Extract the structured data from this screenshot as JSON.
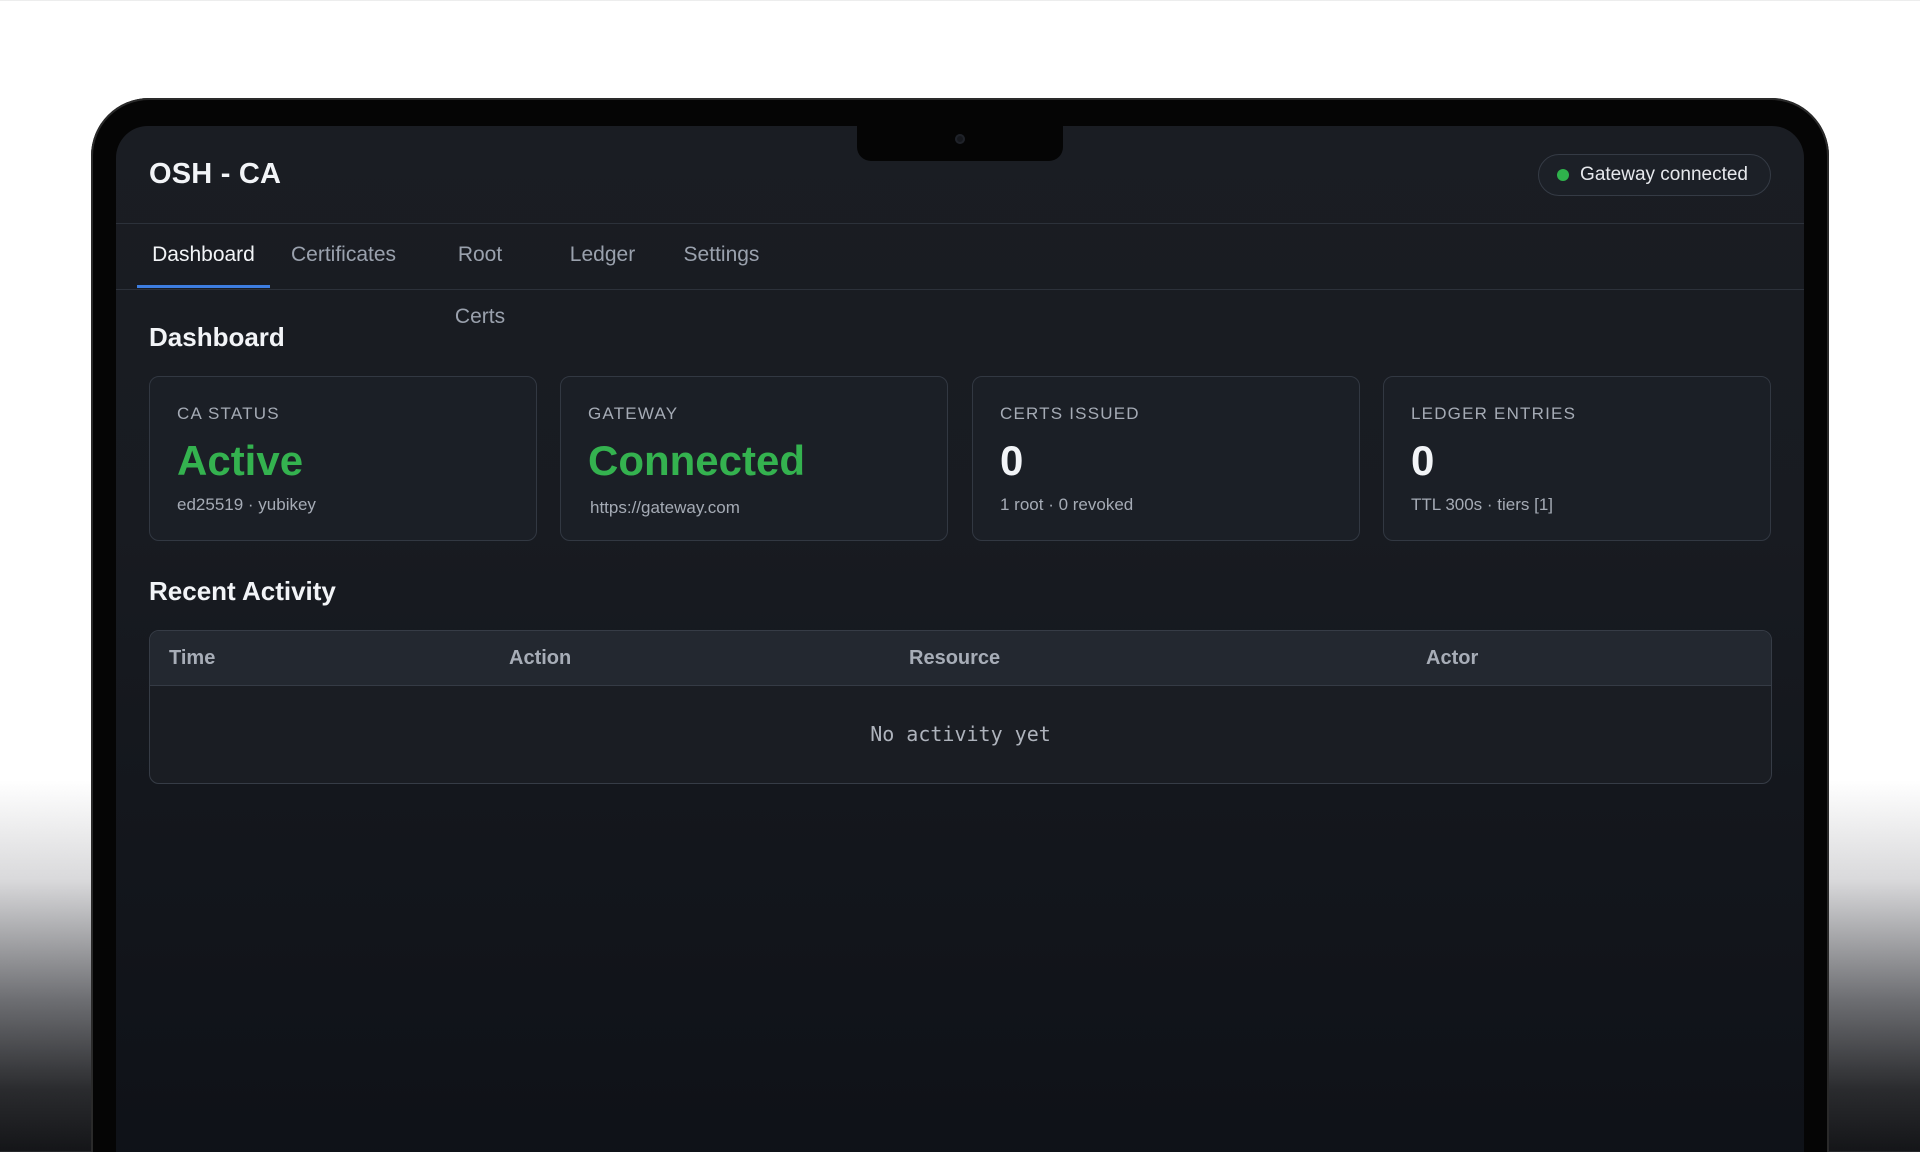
{
  "app": {
    "title": "OSH - CA",
    "gateway_status": "Gateway connected",
    "status_color": "#2fb24c"
  },
  "tabs": [
    {
      "label": "Dashboard",
      "active": true
    },
    {
      "label": "Certificates",
      "active": false
    },
    {
      "label": "Root Certs",
      "active": false
    },
    {
      "label": "Ledger",
      "active": false
    },
    {
      "label": "Settings",
      "active": false
    }
  ],
  "page": {
    "title": "Dashboard"
  },
  "cards": [
    {
      "label": "CA STATUS",
      "value": "Active",
      "sub": "ed25519 · yubikey",
      "value_color": "#34b24f"
    },
    {
      "label": "GATEWAY",
      "value": "Connected",
      "sub": "https://gateway.com",
      "value_color": "#34b24f"
    },
    {
      "label": "CERTS ISSUED",
      "value": "0",
      "sub": "1 root · 0 revoked",
      "value_color": "#f2f4f7"
    },
    {
      "label": "LEDGER ENTRIES",
      "value": "0",
      "sub": "TTL 300s · tiers [1]",
      "value_color": "#f2f4f7"
    }
  ],
  "activity": {
    "title": "Recent Activity",
    "columns": [
      "Time",
      "Action",
      "Resource",
      "Actor"
    ],
    "empty_text": "No activity yet"
  },
  "icons": {
    "status_dot": "status-dot-icon",
    "camera": "camera-icon"
  },
  "colors": {
    "accent": "#3d7de0",
    "success": "#34b24f",
    "background": "#1a1d23"
  }
}
